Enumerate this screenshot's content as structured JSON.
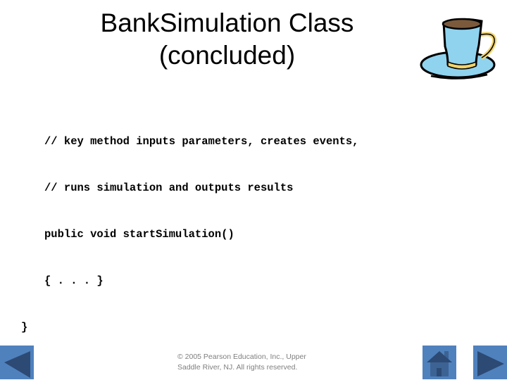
{
  "slide": {
    "title_line1": "BankSimulation Class",
    "title_line2": "(concluded)",
    "code_lines": [
      "// key method inputs parameters, creates events,",
      "// runs simulation and outputs results",
      "public void startSimulation()",
      "{ . . . }",
      "}"
    ],
    "footer_line1": "© 2005 Pearson Education, Inc., Upper",
    "footer_line2": "Saddle River, NJ.  All rights reserved."
  },
  "navigation": {
    "prev_icon": "triangle-left-icon",
    "home_icon": "house-icon",
    "next_icon": "triangle-right-icon",
    "button_color": "#4f81bd",
    "glyph_color": "#2c4a74"
  },
  "decoration": {
    "cup_icon": "coffee-cup-icon",
    "cup_color": "#8fd3ef",
    "coffee_color": "#7b5a3c",
    "accent_color": "#f2d36b"
  }
}
